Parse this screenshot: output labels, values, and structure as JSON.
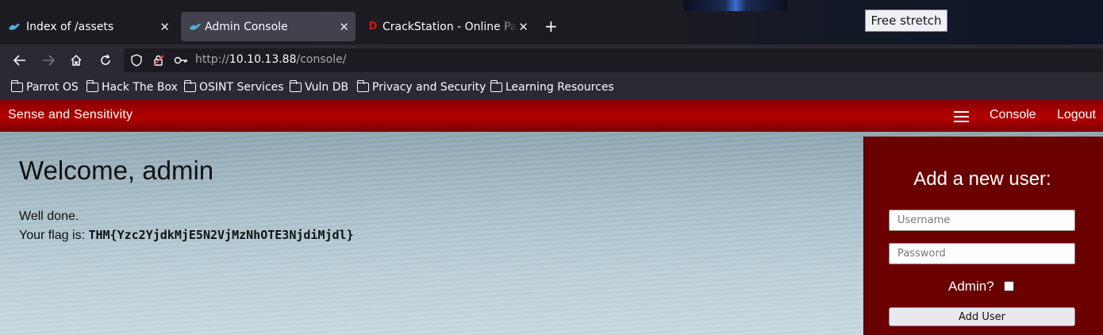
{
  "browser": {
    "tabs": [
      {
        "title": "Index of /assets",
        "active": false
      },
      {
        "title": "Admin Console",
        "active": true
      },
      {
        "title": "CrackStation - Online Pas",
        "active": false
      }
    ],
    "tooltip": "Free stretch",
    "url": {
      "scheme": "http://",
      "host": "10.10.13.88",
      "path": "/console/"
    },
    "bookmarks": [
      "Parrot OS",
      "Hack The Box",
      "OSINT Services",
      "Vuln DB",
      "Privacy and Security",
      "Learning Resources"
    ],
    "crackstation_favicon_letter": "D"
  },
  "site": {
    "brand": "Sense and Sensitivity",
    "nav": [
      "Console",
      "Logout"
    ],
    "welcome": "Welcome, admin",
    "line1": "Well done.",
    "flag_prefix": "Your flag is: ",
    "flag": "THM{Yzc2YjdkMjE5N2VjMzNhOTE3NjdiMjdl}"
  },
  "form": {
    "title": "Add a new user:",
    "username_placeholder": "Username",
    "password_placeholder": "Password",
    "admin_label": "Admin?",
    "admin_checked": false,
    "submit": "Add User"
  },
  "colors": {
    "navbar_red": "#b30000",
    "panel_red": "#6b0000"
  }
}
